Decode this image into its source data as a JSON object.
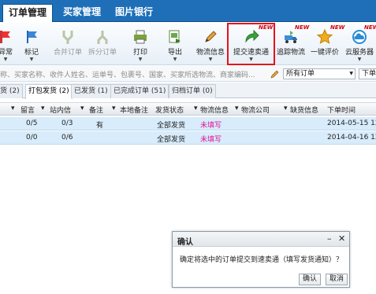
{
  "nav": {
    "tabs": [
      "订单管理",
      "买家管理",
      "图片银行"
    ]
  },
  "toolbar": {
    "items": [
      {
        "label": "异常",
        "icon": "flag-icon",
        "caret": "▼"
      },
      {
        "label": "标记",
        "icon": "blue-flag-icon",
        "caret": "▼"
      },
      {
        "label": "合并订单",
        "icon": "merge-icon"
      },
      {
        "label": "拆分订单",
        "icon": "split-icon"
      },
      {
        "label": "打印",
        "icon": "printer-icon",
        "caret": "▼"
      },
      {
        "label": "导出",
        "icon": "export-icon",
        "caret": "▼"
      },
      {
        "label": "物流信息",
        "icon": "pencil-icon",
        "caret": "▼"
      },
      {
        "label": "提交速卖通",
        "icon": "green-arrow-icon",
        "caret": "▼",
        "badge": "NEW"
      },
      {
        "label": "追踪物流",
        "icon": "truck-icon",
        "badge": "NEW"
      },
      {
        "label": "一键评价",
        "icon": "star-icon",
        "badge": "NEW"
      },
      {
        "label": "云服务器",
        "icon": "cloud-icon",
        "caret": "▼",
        "badge": "NEW"
      }
    ]
  },
  "filter": {
    "search_text": "称、买家名称、收件人姓名、运单号、包裹号、国家、买家所选物流、商家编码...",
    "select_value": "所有订单",
    "select_caret": "▼",
    "select2_value": "下单"
  },
  "subtabs": [
    "货 (2)",
    "打包发货 (2)",
    "已发货 (1)",
    "已完成订单 (51)",
    "归档订单 (0)"
  ],
  "table": {
    "headers": [
      "留言",
      "站内信",
      "备注",
      "本地备注",
      "发货状态",
      "物流信息",
      "物流公司",
      "缺货信息",
      "下单时间"
    ],
    "rows": [
      {
        "msg": "0/5",
        "mail": "0/3",
        "note": "有",
        "local": "",
        "status": "全部发货",
        "logistics": "未填写",
        "company": "",
        "stock": "",
        "time": "2014-05-15 12"
      },
      {
        "msg": "0/0",
        "mail": "0/6",
        "note": "",
        "local": "",
        "status": "全部发货",
        "logistics": "未填写",
        "company": "",
        "stock": "",
        "time": "2014-04-16 12"
      }
    ]
  },
  "dialog": {
    "title": "确认",
    "minimize": "–",
    "close": "✕",
    "message": "确定将选中的订单提交到速卖通（填写发货通知）？",
    "ok": "确认",
    "cancel": "取消"
  },
  "colors": {
    "nav": "#1e6fb8",
    "highlight_border": "#e4121c",
    "row_selected": "#d8ecfb",
    "link_red": "#e0149a",
    "badge": "#d4000c"
  }
}
